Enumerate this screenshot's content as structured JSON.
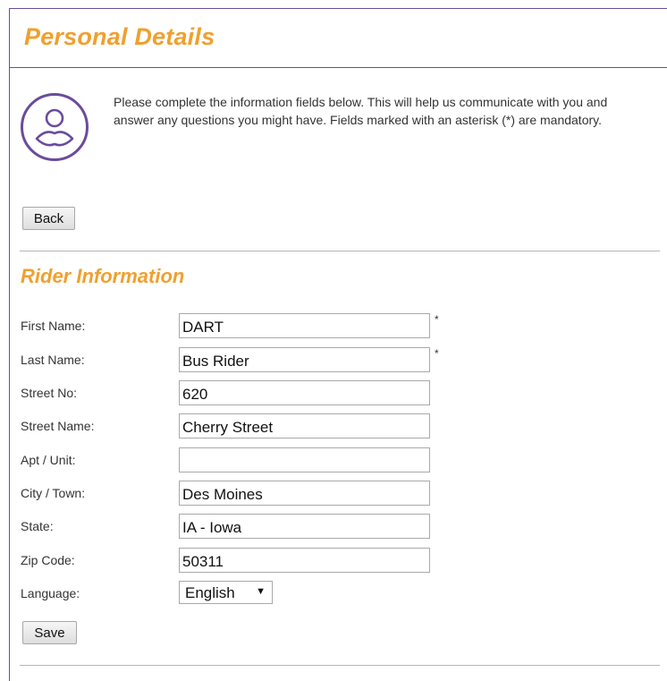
{
  "header": {
    "title": "Personal Details"
  },
  "intro": {
    "text": "Please complete the information fields below. This will help us communicate with you and answer any questions you might have. Fields marked with an asterisk (*) are mandatory.",
    "icon": "user-icon"
  },
  "buttons": {
    "back_label": "Back",
    "save_label": "Save"
  },
  "section": {
    "title": "Rider Information"
  },
  "required_marker": "*",
  "fields": [
    {
      "label": "First Name:",
      "value": "DART",
      "required": true
    },
    {
      "label": "Last Name:",
      "value": "Bus Rider",
      "required": true
    },
    {
      "label": "Street No:",
      "value": "620",
      "required": false
    },
    {
      "label": "Street Name:",
      "value": "Cherry Street",
      "required": false
    },
    {
      "label": "Apt / Unit:",
      "value": "",
      "required": false
    },
    {
      "label": "City / Town:",
      "value": "Des Moines",
      "required": false
    },
    {
      "label": "State:",
      "value": "IA - Iowa",
      "required": false
    },
    {
      "label": "Zip Code:",
      "value": "50311",
      "required": false
    }
  ],
  "language": {
    "label": "Language:",
    "selected": "English",
    "arrow_icon": "dropdown-arrow-icon"
  },
  "colors": {
    "accent": "#f0a02e",
    "brand_purple": "#6a4c9c",
    "rule": "#b5b5b5"
  }
}
